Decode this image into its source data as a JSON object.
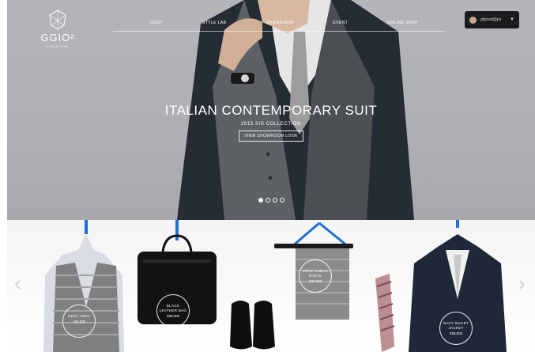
{
  "brand": {
    "name": "GGIO²",
    "tagline": "CURATION"
  },
  "nav": {
    "items": [
      "GGIO²",
      "STYLE LAB",
      "SHOWROOM",
      "EVENT",
      "ONLINE SHOP"
    ]
  },
  "language": {
    "label": "ghjosdi@ps"
  },
  "hero": {
    "title": "ITALIAN CONTEMPORARY SUIT",
    "subtitle": "2015 S/S COLLECTION",
    "button_label": "VIEW SHOWROOM LOOK",
    "slides": 4,
    "active_slide": 1
  },
  "products": [
    {
      "name": "GRAY VEST",
      "price": "198,000"
    },
    {
      "name": "BLACK LEATHER BAG",
      "price": "298,000"
    },
    {
      "name": "GRAY CHECK PANTS",
      "price": "298,000"
    },
    {
      "name": "NAVY SILKET JACKET",
      "price": "398,000"
    }
  ],
  "icons": {
    "left": "chevron-left-icon",
    "right": "chevron-right-icon"
  },
  "colors": {
    "hero_bg": "#afb1b5",
    "lang_bg": "#1b1b1d",
    "hanger": "#1f6fd1"
  }
}
